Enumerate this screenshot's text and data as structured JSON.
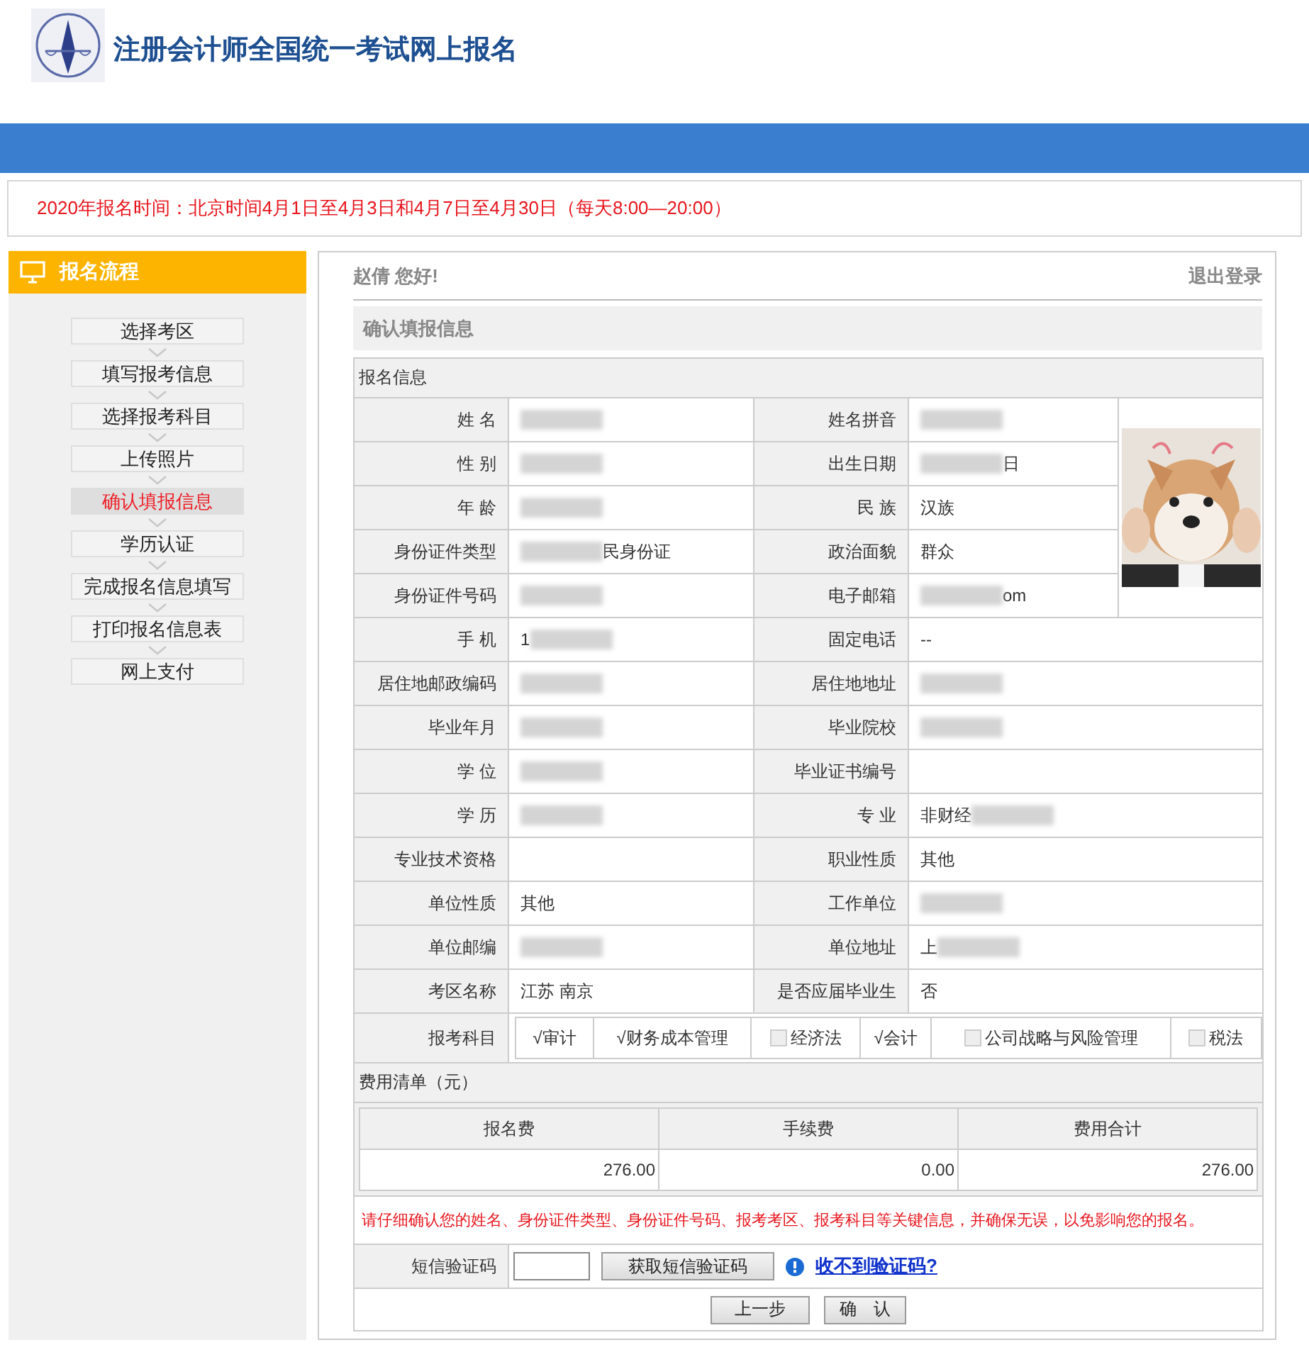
{
  "header": {
    "title": "注册会计师全国统一考试网上报名"
  },
  "notice": "2020年报名时间：北京时间4月1日至4月3日和4月7日至4月30日（每天8:00—20:00）",
  "sidebar": {
    "title": "报名流程",
    "steps": [
      {
        "label": "选择考区",
        "selected": false
      },
      {
        "label": "填写报考信息",
        "selected": false
      },
      {
        "label": "选择报考科目",
        "selected": false
      },
      {
        "label": "上传照片",
        "selected": false
      },
      {
        "label": "确认填报信息",
        "selected": true
      },
      {
        "label": "学历认证",
        "selected": false
      },
      {
        "label": "完成报名信息填写",
        "selected": false
      },
      {
        "label": "打印报名信息表",
        "selected": false
      },
      {
        "label": "网上支付",
        "selected": false
      }
    ]
  },
  "greeting": "赵倩 您好!",
  "logout": "退出登录",
  "section_title": "确认填报信息",
  "info": {
    "title": "报名信息",
    "rows": [
      {
        "cells": [
          {
            "label": "姓 名",
            "blurred_before": true
          },
          {
            "label": "姓名拼音",
            "blurred_before": true
          }
        ]
      },
      {
        "cells": [
          {
            "label": "性 别",
            "blurred_before": true
          },
          {
            "label": "出生日期",
            "value": "日",
            "blurred_before": true
          }
        ]
      },
      {
        "cells": [
          {
            "label": "年 龄",
            "blurred_before": true
          },
          {
            "label": "民 族",
            "value": "汉族"
          }
        ]
      },
      {
        "cells": [
          {
            "label": "身份证件类型",
            "value": "民身份证",
            "blurred_before": true
          },
          {
            "label": "政治面貌",
            "value": "群众"
          }
        ]
      },
      {
        "cells": [
          {
            "label": "身份证件号码",
            "blurred_before": true
          },
          {
            "label": "电子邮箱",
            "value": "om",
            "blurred_before": true
          }
        ]
      },
      {
        "cells": [
          {
            "label": "手 机",
            "value": "1",
            "blurred_after": true
          },
          {
            "label": "固定电话",
            "value": "--"
          }
        ]
      },
      {
        "cells": [
          {
            "label": "居住地邮政编码",
            "blurred_before": true
          },
          {
            "label": "居住地地址",
            "blurred_before": true
          }
        ]
      },
      {
        "cells": [
          {
            "label": "毕业年月",
            "blurred_before": true
          },
          {
            "label": "毕业院校",
            "blurred_before": true
          }
        ]
      },
      {
        "cells": [
          {
            "label": "学 位",
            "blurred_before": true
          },
          {
            "label": "毕业证书编号"
          }
        ]
      },
      {
        "cells": [
          {
            "label": "学 历",
            "blurred_before": true
          },
          {
            "label": "专 业",
            "value": "非财经",
            "blurred_after": true
          }
        ]
      },
      {
        "cells": [
          {
            "label": "专业技术资格"
          },
          {
            "label": "职业性质",
            "value": "其他"
          }
        ]
      },
      {
        "cells": [
          {
            "label": "单位性质",
            "value": "其他"
          },
          {
            "label": "工作单位",
            "blurred_before": true
          }
        ]
      },
      {
        "cells": [
          {
            "label": "单位邮编",
            "blurred_before": true
          },
          {
            "label": "单位地址",
            "value": "上",
            "blurred_after": true
          }
        ]
      },
      {
        "cells": [
          {
            "label": "考区名称",
            "value": "江苏 南京"
          },
          {
            "label": "是否应届毕业生",
            "value": "否"
          }
        ]
      }
    ],
    "subjects": {
      "label": "报考科目",
      "check_mark": "√",
      "items": [
        {
          "label": "审计",
          "checked": true
        },
        {
          "label": "财务成本管理",
          "checked": true
        },
        {
          "label": "经济法",
          "checked": false
        },
        {
          "label": "会计",
          "checked": true
        },
        {
          "label": "公司战略与风险管理",
          "checked": false
        },
        {
          "label": "税法",
          "checked": false
        }
      ]
    }
  },
  "fees": {
    "title": "费用清单（元）",
    "columns": [
      "报名费",
      "手续费",
      "费用合计"
    ],
    "values": [
      "276.00",
      "0.00",
      "276.00"
    ]
  },
  "warning": "请仔细确认您的姓名、身份证件类型、身份证件号码、报考考区、报考科目等关键信息，并确保无误，以免影响您的报名。",
  "sms": {
    "label": "短信验证码",
    "button": "获取短信验证码",
    "help_link": "收不到验证码?"
  },
  "actions": [
    "上一步",
    "确　认"
  ]
}
